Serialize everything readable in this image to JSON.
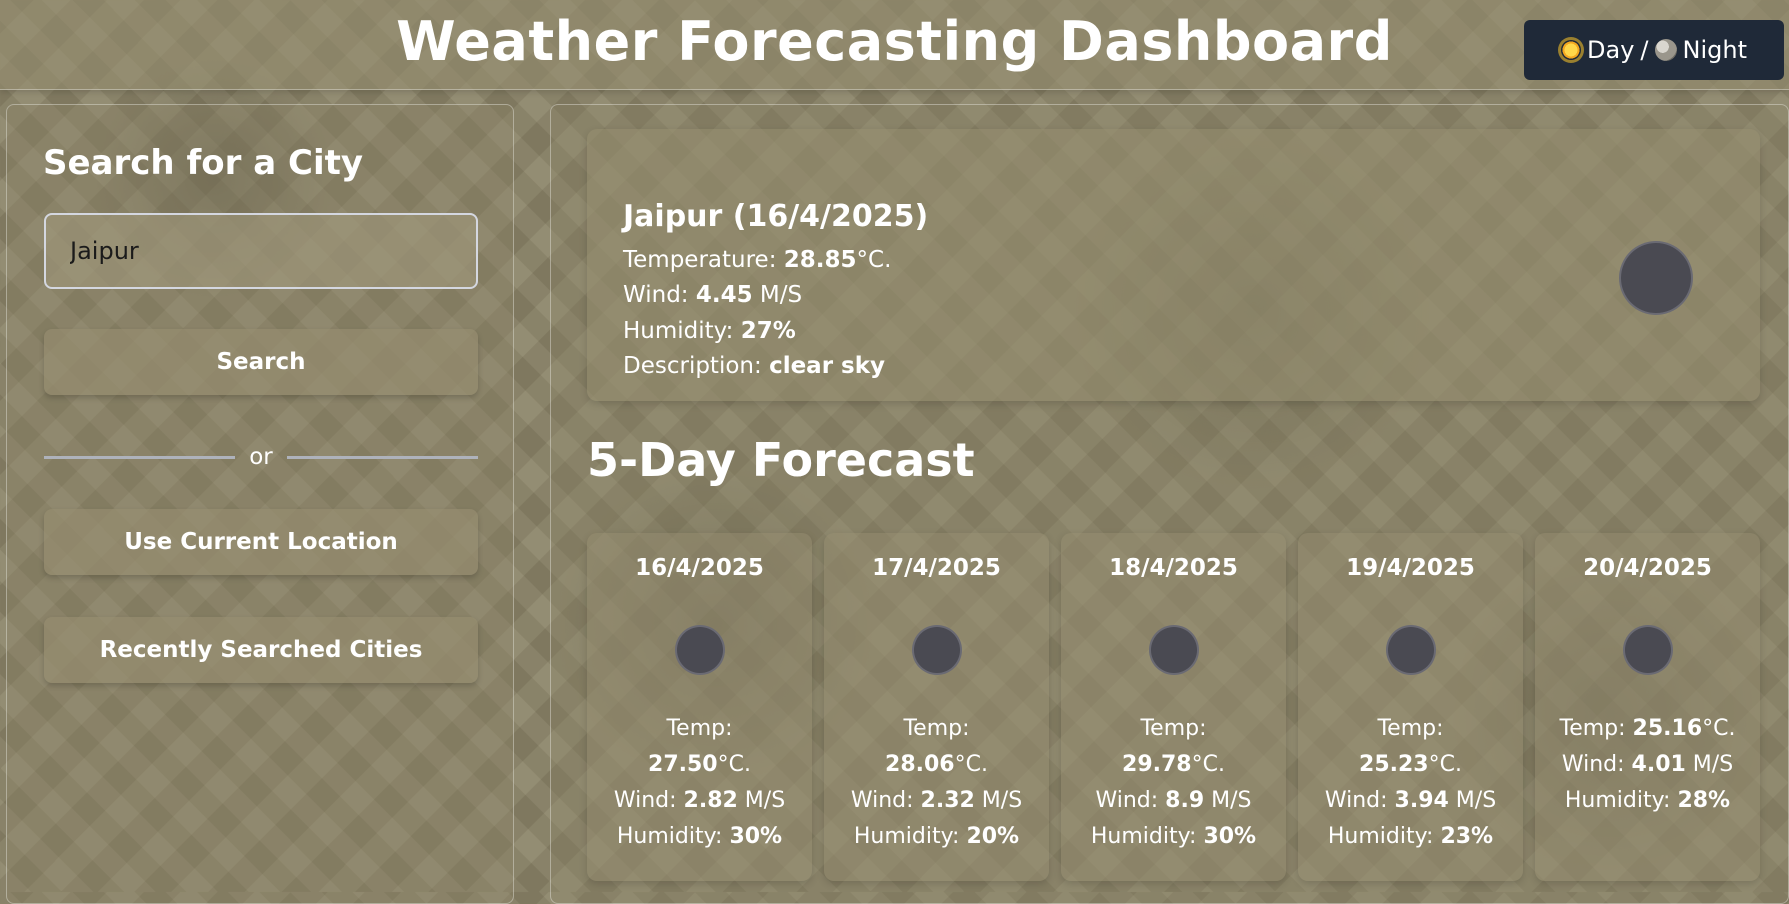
{
  "header": {
    "title": "Weather Forecasting Dashboard",
    "theme_toggle": {
      "day_label": "Day",
      "separator": "/",
      "night_label": "Night",
      "day_icon": "sun-icon",
      "night_icon": "moon-icon"
    }
  },
  "sidebar": {
    "title": "Search for a City",
    "search_input": {
      "value": "Jaipur",
      "placeholder": ""
    },
    "search_button": "Search",
    "divider_text": "or",
    "location_button": "Use Current Location",
    "recent_button": "Recently Searched Cities"
  },
  "current": {
    "title": "Jaipur (16/4/2025)",
    "temperature": {
      "label": "Temperature: ",
      "value": "28.85",
      "unit": "°C."
    },
    "wind": {
      "label": "Wind: ",
      "value": "4.45",
      "unit": " M/S"
    },
    "humidity": {
      "label": "Humidity: ",
      "value": "27%"
    },
    "description": {
      "label": "Description: ",
      "value": "clear sky"
    },
    "icon": "weather-icon"
  },
  "forecast": {
    "title": "5-Day Forecast",
    "temp_label": "Temp: ",
    "temp_unit": "°C.",
    "wind_label": "Wind: ",
    "wind_unit": " M/S",
    "humidity_label": "Humidity: ",
    "days": [
      {
        "date": "16/4/2025",
        "temp": "27.50",
        "wind": "2.82",
        "humidity": "30%"
      },
      {
        "date": "17/4/2025",
        "temp": "28.06",
        "wind": "2.32",
        "humidity": "20%"
      },
      {
        "date": "18/4/2025",
        "temp": "29.78",
        "wind": "8.9",
        "humidity": "30%"
      },
      {
        "date": "19/4/2025",
        "temp": "25.23",
        "wind": "3.94",
        "humidity": "23%"
      },
      {
        "date": "20/4/2025",
        "temp": "25.16",
        "wind": "4.01",
        "humidity": "28%"
      }
    ]
  },
  "colors": {
    "toggle_background": "#1f2938",
    "text": "#ffffff",
    "input_border": "#d4d7e0",
    "icon_placeholder": "#4a4a52"
  }
}
